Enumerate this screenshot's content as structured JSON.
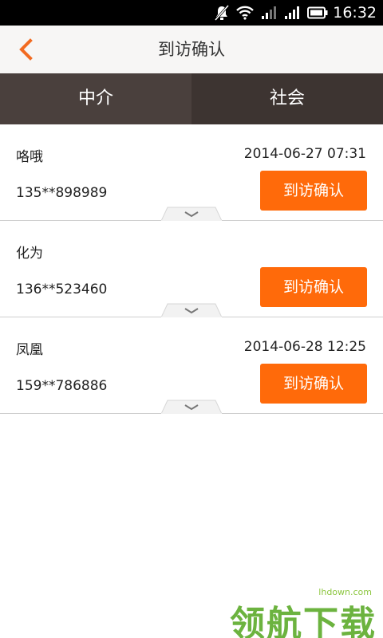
{
  "status_bar": {
    "time": "16:32"
  },
  "header": {
    "title": "到访确认"
  },
  "tabs": [
    {
      "label": "中介"
    },
    {
      "label": "社会"
    }
  ],
  "visits": [
    {
      "name": "咯哦",
      "date": "2014-06-27 07:31",
      "phone": "135**898989",
      "button": "到访确认"
    },
    {
      "name": "化为",
      "date": "",
      "phone": "136**523460",
      "button": "到访确认"
    },
    {
      "name": "凤凰",
      "date": "2014-06-28 12:25",
      "phone": "159**786886",
      "button": "到访确认"
    }
  ],
  "watermark": {
    "url": "lhdown.com",
    "logo": "领航下载"
  },
  "colors": {
    "accent": "#ff6a0a",
    "tab_bg": "#4a403d",
    "header_bg": "#f7f6f5"
  }
}
